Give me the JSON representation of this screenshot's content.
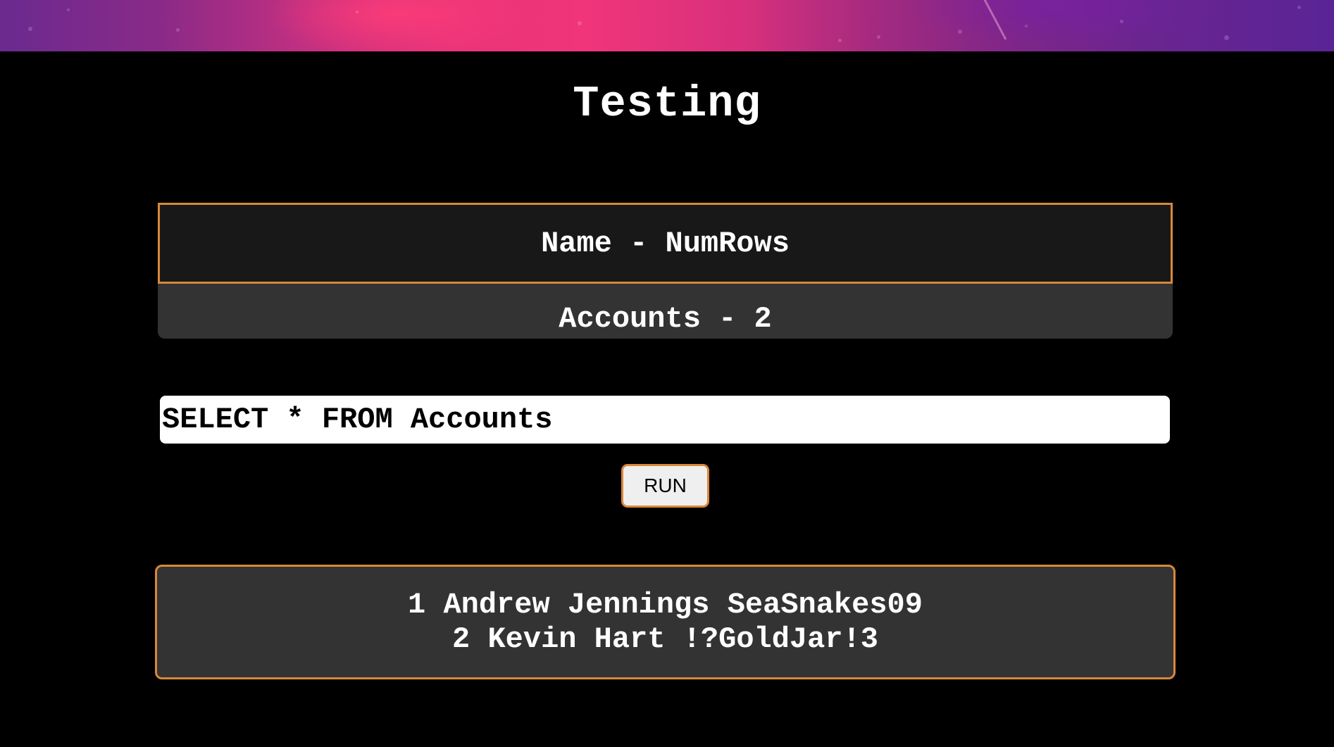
{
  "page": {
    "title": "Testing"
  },
  "tables": {
    "header": "Name - NumRows",
    "rows": [
      "Accounts - 2"
    ]
  },
  "query": {
    "value": "SELECT * FROM Accounts"
  },
  "run_button": {
    "label": "RUN"
  },
  "results": {
    "rows": [
      "1 Andrew Jennings SeaSnakes09",
      "2 Kevin Hart !?GoldJar!3"
    ]
  },
  "colors": {
    "background": "#000000",
    "accent_border": "#d9873a",
    "panel_dark": "#181818",
    "panel": "#333333"
  }
}
